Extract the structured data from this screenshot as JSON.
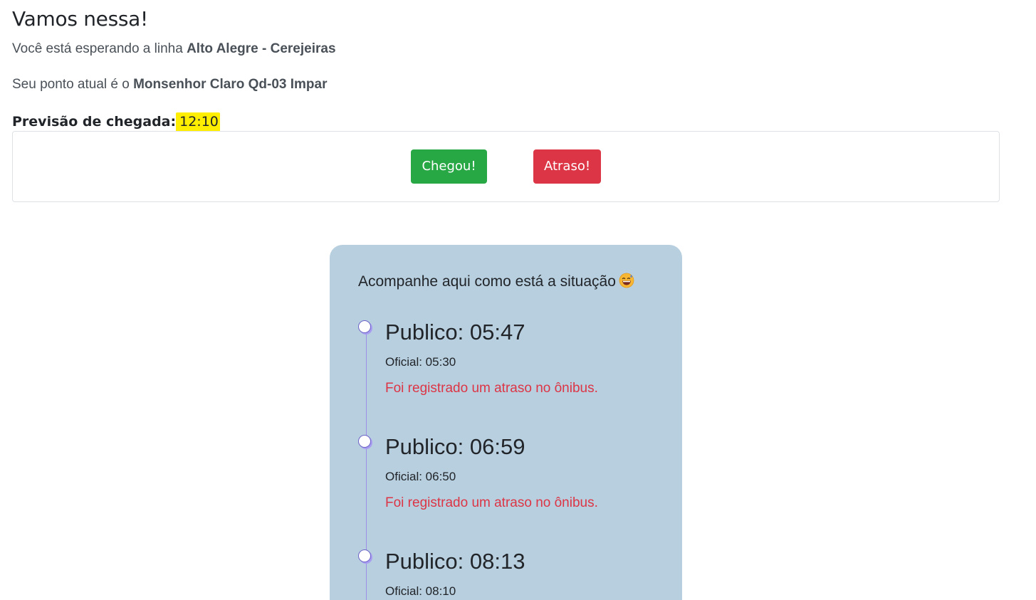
{
  "header": {
    "title": "Vamos nessa!",
    "line_prefix": "Você está esperando a linha ",
    "line_name": "Alto Alegre - Cerejeiras",
    "stop_prefix": "Seu ponto atual é o ",
    "stop_name": "Monsenhor Claro Qd-03 Impar",
    "eta_label": "Previsão de chegada:",
    "eta_time": "12:10",
    "eta_highlight_color": "#ffee00"
  },
  "actions": {
    "arrived_label": "Chegou!",
    "delay_label": "Atraso!",
    "arrived_color": "#28a745",
    "delay_color": "#dc3545"
  },
  "timeline": {
    "header": "Acompanhe aqui como está a situação",
    "header_icon": "smiling-face-with-sweat-emoji",
    "background_color": "#b8cfdf",
    "items": [
      {
        "title": "Publico: 05:47",
        "official": "Oficial: 05:30",
        "alert": "Foi registrado um atraso no ônibus."
      },
      {
        "title": "Publico: 06:59",
        "official": "Oficial: 06:50",
        "alert": "Foi registrado um atraso no ônibus."
      },
      {
        "title": "Publico: 08:13",
        "official": "Oficial: 08:10"
      }
    ]
  }
}
